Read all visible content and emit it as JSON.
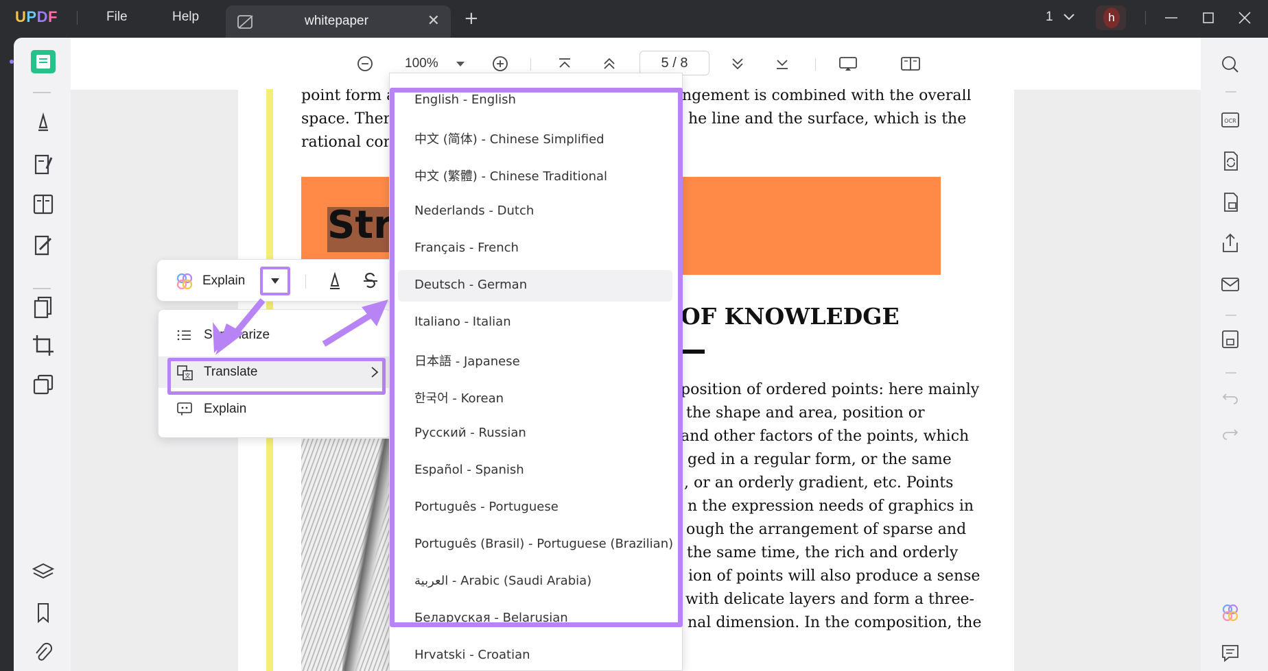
{
  "app": {
    "brand": "UPDF",
    "menu": [
      "File",
      "Help"
    ],
    "tab_title": "whitepaper",
    "page_indicator": "1",
    "user_initial": "h"
  },
  "toolbar": {
    "zoom": "100%",
    "page_current": "5",
    "page_sep": "/",
    "page_total": "8"
  },
  "document": {
    "lines_top": [
      "point form a",
      "space. Ther",
      "rational con"
    ],
    "lines_top_right": [
      "ngement is combined with the overall",
      "he line and the surface, which is the"
    ],
    "banner_text": "Str",
    "heading": "OF KNOWLEDGE",
    "body_right": [
      "position of ordered points: here mainly",
      "the shape and area, position or",
      "and other factors of the points, which",
      "ged in a regular form, or the same",
      ", or an orderly gradient, etc. Points",
      "n the expression needs of graphics in",
      "ough the arrangement of sparse and",
      "the same time, the rich and orderly",
      "ion of points will also produce a sense",
      "with delicate layers and form a three-",
      "nal dimension. In the composition, the"
    ]
  },
  "mini_toolbar": {
    "explain_label": "Explain"
  },
  "ai_menu": {
    "items": [
      {
        "label": "Summarize"
      },
      {
        "label": "Translate"
      },
      {
        "label": "Explain"
      }
    ]
  },
  "languages": [
    "English - English",
    "中文 (简体) - Chinese Simplified",
    "中文 (繁體) - Chinese Traditional",
    "Nederlands - Dutch",
    "Français - French",
    "Deutsch - German",
    "Italiano - Italian",
    "日本語 - Japanese",
    "한국어 - Korean",
    "Русский - Russian",
    "Español - Spanish",
    "Português - Portuguese",
    "Português (Brasil) - Portuguese (Brazilian)",
    "العربية - Arabic (Saudi Arabia)",
    "Беларуская - Belarusian",
    "Hrvatski - Croatian"
  ],
  "colors": {
    "accent": "#b884f5",
    "banner": "#ff8a47",
    "highlight_bar": "#f4ef74",
    "titlebar": "#2b2d31"
  }
}
